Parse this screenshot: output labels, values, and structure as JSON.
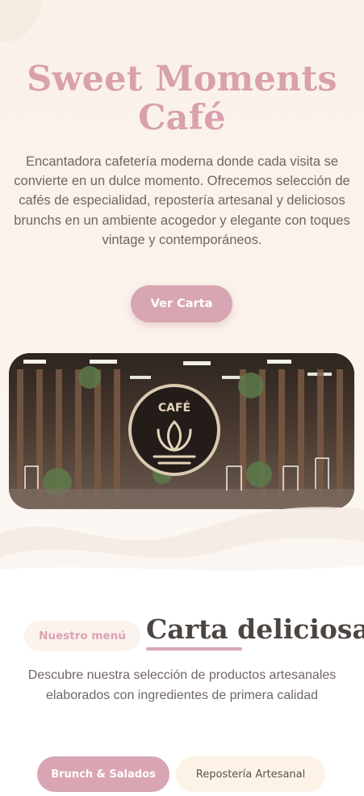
{
  "hero": {
    "title_line1": "Sweet Moments",
    "title_line2": "Café",
    "description": "Encantadora cafetería moderna donde cada visita se convierte en un dulce momento. Ofrecemos selección de cafés de especialidad, repostería artesanal y deliciosos brunchs en un ambiente acogedor y elegante con toques vintage y contemporáneos.",
    "cta_label": "Ver Carta",
    "image_sign_text": "CAFÉ"
  },
  "menu": {
    "pill_label": "Nuestro menú",
    "title": "Carta deliciosa",
    "description": "Descubre nuestra selección de productos artesanales elaborados con ingredientes de primera calidad",
    "tabs": [
      {
        "label": "Brunch & Salados",
        "active": true
      },
      {
        "label": "Repostería Artesanal",
        "active": false
      }
    ]
  },
  "colors": {
    "accent": "#d8a6b3",
    "hero_bg": "#f9f1ea",
    "title_pink": "#d9a0ae",
    "text": "#6f6663",
    "heading": "#4c4542"
  }
}
